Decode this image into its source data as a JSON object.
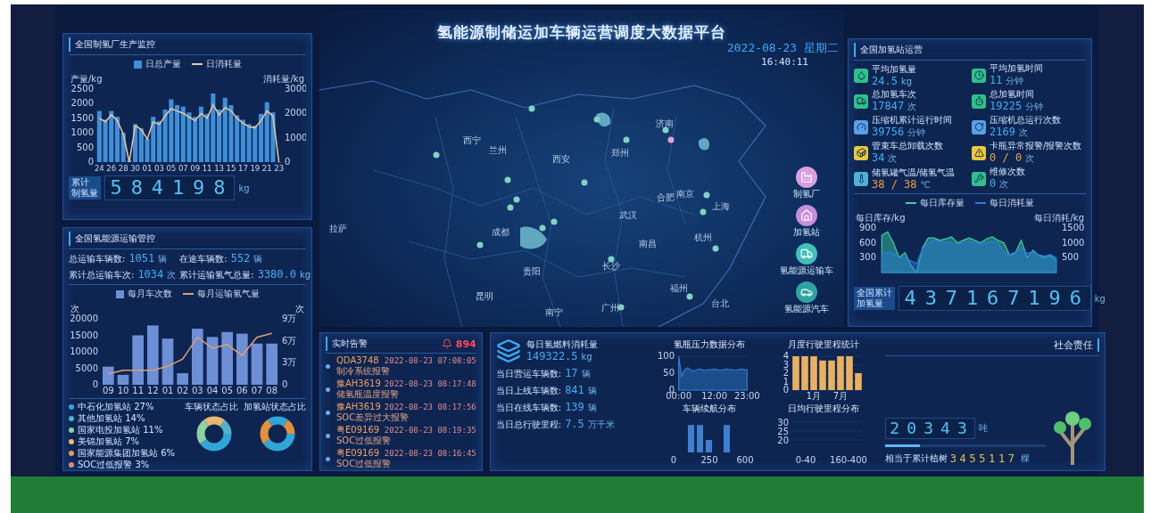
{
  "header": {
    "title": "氢能源制储运加车辆运营调度大数据平台",
    "date": "2022-08-23 星期二",
    "time": "16:40:11"
  },
  "production_panel": {
    "title": "全国制氢厂生产监控",
    "chart_data": {
      "type": "bar",
      "ylabel": "产量/kg",
      "ylim": [
        0,
        2500
      ],
      "yticks": [
        0,
        500,
        1000,
        1500,
        2000,
        2500
      ],
      "categories": [
        "24",
        null,
        "26",
        null,
        "28",
        null,
        "30",
        null,
        "01",
        null,
        "03",
        null,
        "05",
        null,
        "07",
        null,
        "09",
        null,
        "11",
        null,
        "13",
        null,
        "15",
        null,
        "17",
        null,
        "19",
        null,
        "21",
        null,
        "23"
      ],
      "series": [
        {
          "name": "日总产量",
          "color": "#3f8fd8",
          "values": [
            1750,
            1450,
            1750,
            1550,
            1000,
            50,
            1300,
            1150,
            800,
            1550,
            1400,
            1800,
            2150,
            1950,
            1900,
            1700,
            1550,
            1900,
            1650,
            2350,
            1800,
            2200,
            1950,
            1600,
            1450,
            1300,
            1250,
            1650,
            2050,
            1700,
            0
          ]
        },
        {
          "name": "日消耗量",
          "type": "line",
          "color": "#e9c89a",
          "values": [
            1500,
            1380,
            1620,
            1420,
            960,
            0,
            1250,
            1120,
            790,
            1370,
            1290,
            1580,
            1830,
            1750,
            1670,
            1540,
            1420,
            1670,
            1500,
            1960,
            1620,
            1870,
            1750,
            1500,
            1330,
            1210,
            1170,
            1420,
            1750,
            1580,
            0
          ]
        }
      ]
    },
    "right_axis": {
      "label": "消耗量/kg",
      "ticks": [
        "3000",
        "2000",
        "1000",
        "0"
      ]
    },
    "counter": {
      "label_lines": [
        "累计",
        "制氢量"
      ],
      "digits": "584198",
      "unit": "kg"
    }
  },
  "transport_panel": {
    "title": "全国氢能源运输管控",
    "stats": [
      {
        "label": "总运输车辆数:",
        "value": "1051",
        "unit": "辆"
      },
      {
        "label": "在途车辆数:",
        "value": "552",
        "unit": "辆"
      },
      {
        "label": "累计总运输车次:",
        "value": "1034",
        "unit": "次"
      },
      {
        "label": "累计运输氢气总量:",
        "value": "3380.0",
        "unit": "kg"
      }
    ],
    "chart_data": {
      "type": "bar",
      "ylabel": "次",
      "categories": [
        "09",
        "10",
        "11",
        "12",
        "01",
        "02",
        "03",
        "04",
        "05",
        "06",
        "07",
        "08"
      ],
      "ylim": [
        0,
        20000
      ],
      "yticks": [
        0,
        5000,
        10000,
        15000,
        20000
      ],
      "series": [
        {
          "name": "每月车次数",
          "color": "#6c8fd6",
          "values": [
            5500,
            3000,
            15000,
            18000,
            14000,
            3500,
            17000,
            14500,
            16000,
            15500,
            12500,
            12500
          ]
        },
        {
          "name": "每月运输氢气量",
          "type": "line",
          "color": "#e0a070",
          "values": [
            3300,
            4400,
            4400,
            4400,
            5600,
            7800,
            14400,
            11100,
            12200,
            8900,
            14400,
            15600
          ]
        }
      ]
    },
    "right_axis": {
      "label": "次",
      "ticks": [
        "9万",
        "6万",
        "3万",
        "0"
      ]
    },
    "legend": [
      {
        "label": "中石化加氢站 27%",
        "color": "#2fa6d8"
      },
      {
        "label": "其他加氢站 14%",
        "color": "#4fb3c8"
      },
      {
        "label": "国家电投加氢站 11%",
        "color": "#8fd0a0"
      },
      {
        "label": "美锦加氢站 7%",
        "color": "#e8b870"
      },
      {
        "label": "国家能源集团加氢站 6%",
        "color": "#e39a5a"
      },
      {
        "label": "SOC过低报警 3%",
        "color": "#d88a7a"
      }
    ],
    "donuts": [
      {
        "title": "车辆状态占比"
      },
      {
        "title": "加氢站状态占比"
      }
    ]
  },
  "map": {
    "cities": [
      "西宁",
      "兰州",
      "西安",
      "郑州",
      "济南",
      "合肥",
      "南京",
      "上海",
      "武汉",
      "拉萨",
      "成都",
      "南昌",
      "杭州",
      "长沙",
      "贵阳",
      "昆明",
      "福州",
      "台北",
      "广州",
      "南宁"
    ],
    "legend": [
      {
        "label": "制氢厂",
        "kind": "factory",
        "color": "#d9a0e0"
      },
      {
        "label": "加氢站",
        "kind": "station",
        "color": "#c78fd8"
      },
      {
        "label": "氢能源运输车",
        "kind": "truck",
        "color": "#3fc1b8"
      },
      {
        "label": "氢能源汽车",
        "kind": "car",
        "color": "#2fa3a0"
      }
    ]
  },
  "station_panel": {
    "title": "全国加氢站运营",
    "items": [
      {
        "kind": "droplet",
        "label": "平均加氢量",
        "value": "24.5",
        "unit": "kg",
        "highlight": false
      },
      {
        "kind": "clock",
        "label": "平均加氢时间",
        "value": "11",
        "unit": "分钟",
        "highlight": false
      },
      {
        "kind": "truck",
        "label": "总加氢车次",
        "value": "17847",
        "unit": "次",
        "highlight": false
      },
      {
        "kind": "timer",
        "label": "总加氢时间",
        "value": "19225",
        "unit": "分钟",
        "highlight": false
      },
      {
        "kind": "gauge",
        "label": "压缩机累计运行时间",
        "value": "39756",
        "unit": "分钟",
        "highlight": false
      },
      {
        "kind": "rotate",
        "label": "压缩机总运行次数",
        "value": "2169",
        "unit": "次",
        "highlight": false
      },
      {
        "kind": "container",
        "label": "管束车总卸载次数",
        "value": "34",
        "unit": "次",
        "highlight": false
      },
      {
        "kind": "alert",
        "label": "卡瓶异常报警/报警次数",
        "value": "0 / 0",
        "unit": "次",
        "highlight": true
      },
      {
        "kind": "thermo",
        "label": "储氢罐气温/储氢气温",
        "value": "38 / 38",
        "unit": "℃",
        "highlight": true
      },
      {
        "kind": "wrench",
        "label": "维修次数",
        "value": "0",
        "unit": "次",
        "highlight": false
      }
    ],
    "chart_data": {
      "type": "area",
      "ylabel": "每日库存/kg",
      "ylim": [
        0,
        900
      ],
      "yticks": [
        300,
        600,
        900
      ],
      "series": [
        {
          "name": "每日库存量",
          "color": "#3ad29f",
          "values": [
            750,
            820,
            600,
            300,
            400,
            150,
            0,
            500,
            700,
            700,
            650,
            680,
            720,
            600,
            650,
            700,
            650,
            600,
            680,
            720,
            650,
            600,
            350,
            400,
            650,
            300,
            450,
            350,
            300,
            350,
            250
          ]
        },
        {
          "name": "每日消耗量",
          "color": "#2d7be0",
          "values": [
            360,
            420,
            390,
            300,
            300,
            240,
            180,
            480,
            600,
            660,
            630,
            600,
            600,
            570,
            600,
            630,
            600,
            570,
            600,
            630,
            600,
            420,
            360,
            420,
            480,
            390,
            420,
            360,
            330,
            360,
            300
          ]
        }
      ]
    },
    "right_axis": {
      "label": "每日消耗/kg",
      "ticks": [
        "1500",
        "1000",
        "500"
      ]
    },
    "counter": {
      "label_lines": [
        "全国累计",
        "加氢量"
      ],
      "digits": "437167196",
      "unit": "kg"
    }
  },
  "alerts": {
    "title": "实时告警",
    "count": "894",
    "items": [
      {
        "plate": "QDA3748",
        "message": "制冷系统报警",
        "time": "2022-08-23 07:08:05"
      },
      {
        "plate": "豫AH3619",
        "message": "储氢瓶温度报警",
        "time": "2022-08-23 08:17:48"
      },
      {
        "plate": "豫AH3619",
        "message": "SOC差异过大报警",
        "time": "2022-08-23 08:17:56"
      },
      {
        "plate": "粤E09169",
        "message": "SOC过低报警",
        "time": "2022-08-23 08:19:35"
      },
      {
        "plate": "粤E09169",
        "message": "SOC过低报警",
        "time": "2022-08-23 08:16:45"
      }
    ]
  },
  "operations": {
    "fuel": {
      "label": "每日氢燃料消耗量",
      "value": "149322.5",
      "unit": "kg"
    },
    "stats": [
      {
        "label": "当日营运车辆数:",
        "value": "17",
        "unit": "辆"
      },
      {
        "label": "当日上线车辆数:",
        "value": "841",
        "unit": "辆"
      },
      {
        "label": "当日在线车辆数:",
        "value": "139",
        "unit": "辆"
      },
      {
        "label": "当日总行驶里程:",
        "value": "7.5",
        "unit": "万千米"
      }
    ],
    "mini_charts": [
      {
        "title": "氢瓶压力数据分布",
        "chart_data": {
          "type": "area",
          "grid": true,
          "ylim": [
            0,
            100
          ],
          "yticks": [
            0,
            50,
            100
          ],
          "categories": [
            "00:00",
            null,
            null,
            null,
            null,
            null,
            null,
            null,
            null,
            null,
            null,
            null,
            "12:00",
            null,
            null,
            null,
            null,
            null,
            null,
            null,
            null,
            null,
            null,
            "23:00"
          ],
          "series": [
            {
              "color": "#2f7fd0",
              "values": [
                100,
                40,
                60,
                65,
                60,
                55,
                60,
                62,
                60,
                58,
                60,
                60,
                62,
                60,
                58,
                60,
                62,
                60,
                60,
                58,
                60,
                62,
                60,
                60
              ]
            }
          ]
        }
      },
      {
        "title": "月度行驶里程统计",
        "chart_data": {
          "type": "bar",
          "grid": true,
          "ylim": [
            0,
            4
          ],
          "yticks": [
            0,
            1,
            2,
            3,
            4
          ],
          "categories": [
            null,
            null,
            "1月",
            null,
            null,
            "7月",
            null,
            null
          ],
          "series": [
            {
              "color": "#e8b060",
              "values": [
                4,
                4,
                4,
                3.5,
                3.5,
                4,
                4,
                2
              ]
            }
          ]
        }
      },
      {
        "title": "车辆续航分布",
        "kind": "bars",
        "x_labels": [
          "0",
          "250",
          "600"
        ]
      },
      {
        "title": "日均行驶里程分布",
        "kind": "grid",
        "y_labels": [
          "30",
          "25",
          "20"
        ],
        "x_labels": [
          "0-40",
          "160-400"
        ]
      }
    ]
  },
  "social": {
    "title": "社会责任",
    "digits": "20343",
    "unit": "吨",
    "level": 0.22,
    "tree_label": "相当于累计植树",
    "tree_digits": "3455117",
    "tree_unit": "棵"
  }
}
